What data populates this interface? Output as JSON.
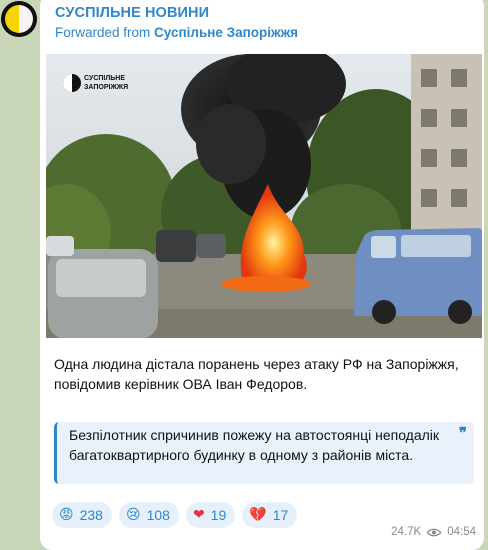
{
  "channel": {
    "name": "СУСПІЛЬНЕ НОВИНИ"
  },
  "forwarded": {
    "prefix": "Forwarded from ",
    "source": "Суспільне Запоріжжя"
  },
  "photo": {
    "watermark": "СУСПІЛЬНЕ ЗАПОРІЖЖЯ"
  },
  "post": {
    "text": "Одна людина дістала поранень через атаку РФ на Запоріжжя, повідомив керівник ОВА Іван Федоров.",
    "quote": "Безпілотник спричинив пожежу на автостоянці неподалік багатоквартирного будинку в одному з районів міста.",
    "quote_icon": "quote-icon"
  },
  "reactions": [
    {
      "emoji": "😡",
      "count": "238"
    },
    {
      "emoji": "😢",
      "count": "108"
    },
    {
      "emoji": "❤",
      "count": "19"
    },
    {
      "emoji": "💔",
      "count": "17"
    }
  ],
  "meta": {
    "views": "24.7K",
    "time": "04:54"
  },
  "colors": {
    "accent": "#2e87c9",
    "chat_bg": "#c9d7b8",
    "quote_bg": "#e9f2fb"
  }
}
